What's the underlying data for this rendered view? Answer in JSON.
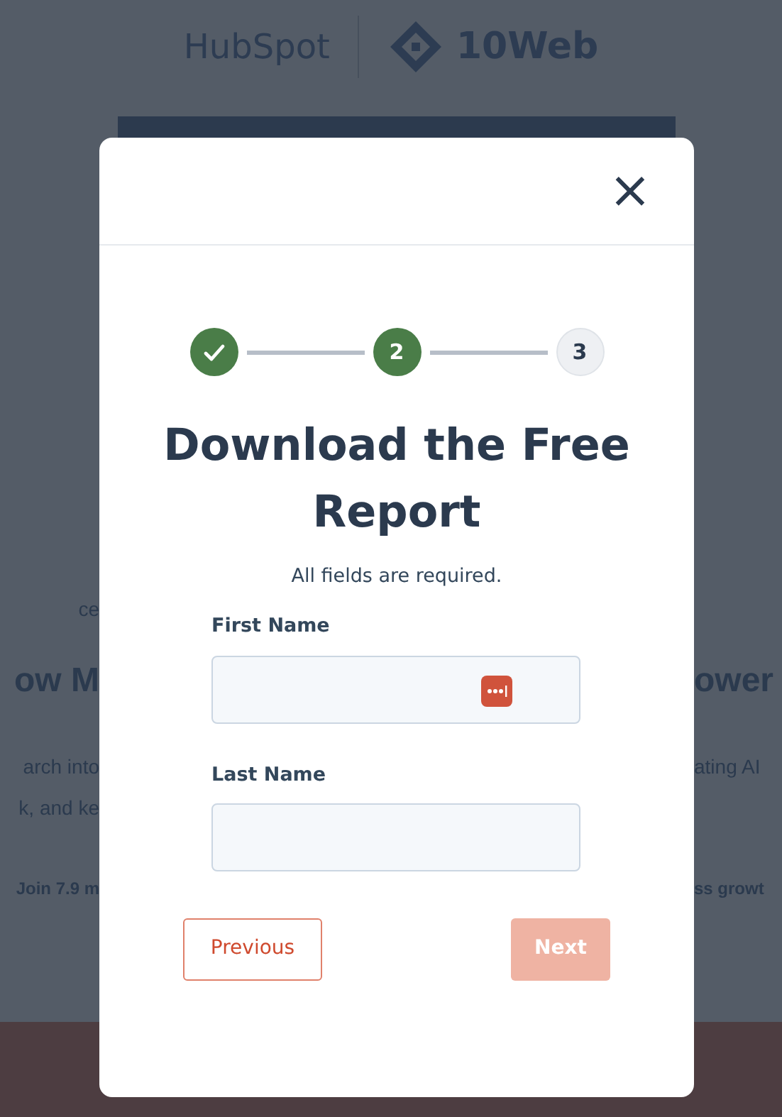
{
  "background": {
    "logos": [
      {
        "kind": "hubspot",
        "text": "HubSpot"
      },
      {
        "kind": "tenweb",
        "text": "10Web"
      }
    ],
    "fragments": [
      {
        "kind": "small",
        "left": "ce"
      },
      {
        "kind": "heading",
        "left": "ow M",
        "right": "ower"
      },
      {
        "kind": "body",
        "left": "arch into",
        "right": "ating AI"
      },
      {
        "kind": "body",
        "left": "k, and ke"
      },
      {
        "kind": "strong",
        "left": "Join 7.9 m",
        "right": "ss growt"
      }
    ]
  },
  "modal": {
    "close": "×",
    "steps": [
      {
        "kind": "done"
      },
      {
        "kind": "current",
        "label": "2"
      },
      {
        "kind": "upcoming",
        "label": "3"
      }
    ],
    "title": "Download the Free Report",
    "note": "All fields are required.",
    "fields": [
      {
        "label": "First Name",
        "password_manager": true
      },
      {
        "label": "Last Name",
        "password_manager": false
      }
    ],
    "buttons": [
      {
        "kind": "secondary",
        "label": "Previous",
        "disabled": false
      },
      {
        "kind": "primary",
        "label": "Next",
        "disabled": true
      }
    ]
  }
}
